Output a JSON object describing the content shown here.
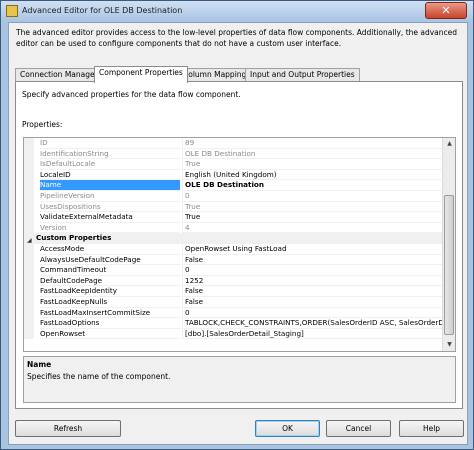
{
  "window": {
    "title": "Advanced Editor for OLE DB Destination",
    "close_glyph": "✕"
  },
  "description": "The advanced editor provides access to the low-level properties of data flow components. Additionally, the advanced editor can be used to configure components that do not have a custom user interface.",
  "tabs": [
    {
      "label": "Connection Managers",
      "active": false
    },
    {
      "label": "Component Properties",
      "active": true
    },
    {
      "label": "Column Mappings",
      "active": false
    },
    {
      "label": "Input and Output Properties",
      "active": false
    }
  ],
  "panel": {
    "description": "Specify advanced properties for the data flow component.",
    "properties_label": "Properties:"
  },
  "properties": [
    {
      "name": "ID",
      "value": "89",
      "state": "disabled"
    },
    {
      "name": "IdentificationString",
      "value": "OLE DB Destination",
      "state": "disabled"
    },
    {
      "name": "IsDefaultLocale",
      "value": "True",
      "state": "disabled"
    },
    {
      "name": "LocaleID",
      "value": "English (United Kingdom)",
      "state": "normal"
    },
    {
      "name": "Name",
      "value": "OLE DB Destination",
      "state": "selected"
    },
    {
      "name": "PipelineVersion",
      "value": "0",
      "state": "disabled"
    },
    {
      "name": "UsesDispositions",
      "value": "True",
      "state": "disabled"
    },
    {
      "name": "ValidateExternalMetadata",
      "value": "True",
      "state": "normal"
    },
    {
      "name": "Version",
      "value": "4",
      "state": "disabled"
    }
  ],
  "custom_category": {
    "label": "Custom Properties",
    "collapse_glyph": "◢"
  },
  "custom_properties": [
    {
      "name": "AccessMode",
      "value": "OpenRowset Using FastLoad"
    },
    {
      "name": "AlwaysUseDefaultCodePage",
      "value": "False"
    },
    {
      "name": "CommandTimeout",
      "value": "0"
    },
    {
      "name": "DefaultCodePage",
      "value": "1252"
    },
    {
      "name": "FastLoadKeepIdentity",
      "value": "False"
    },
    {
      "name": "FastLoadKeepNulls",
      "value": "False"
    },
    {
      "name": "FastLoadMaxInsertCommitSize",
      "value": "0"
    },
    {
      "name": "FastLoadOptions",
      "value": "TABLOCK,CHECK_CONSTRAINTS,ORDER(SalesOrderID ASC, SalesOrderDetailID ASC)"
    },
    {
      "name": "OpenRowset",
      "value": "[dbo].[SalesOrderDetail_Staging]"
    }
  ],
  "scrollbar": {
    "up_glyph": "▲",
    "down_glyph": "▼"
  },
  "help": {
    "title": "Name",
    "text": "Specifies the name of the component."
  },
  "buttons": {
    "refresh": "Refresh",
    "ok": "OK",
    "cancel": "Cancel",
    "help": "Help"
  }
}
